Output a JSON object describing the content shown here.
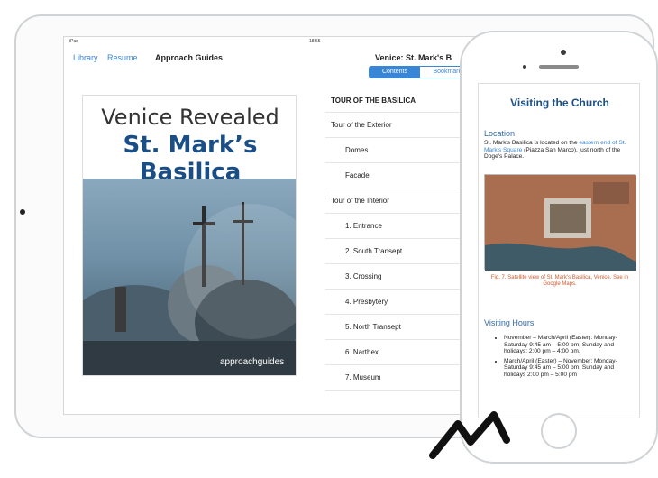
{
  "ipad": {
    "status": {
      "left": "iPad",
      "time": "18:55"
    },
    "nav": {
      "library": "Library",
      "resume": "Resume",
      "title": "Approach Guides",
      "doc_title": "Venice: St. Mark's B"
    },
    "segmented": {
      "selected": "Contents",
      "other": "Bookmarks"
    },
    "cover": {
      "title": "Venice Revealed",
      "subtitle": "St. Mark’s Basilica",
      "logo_text": "approachguides"
    },
    "toc": {
      "section_header": "TOUR OF THE BASILICA",
      "items": [
        {
          "label": "Tour of the Exterior",
          "indent": false
        },
        {
          "label": "Domes",
          "indent": true
        },
        {
          "label": "Facade",
          "indent": true
        },
        {
          "label": "Tour of the Interior",
          "indent": false
        },
        {
          "label": "1. Entrance",
          "indent": true
        },
        {
          "label": "2. South Transept",
          "indent": true
        },
        {
          "label": "3. Crossing",
          "indent": true
        },
        {
          "label": "4. Presbytery",
          "indent": true
        },
        {
          "label": "5. North Transept",
          "indent": true
        },
        {
          "label": "6. Narthex",
          "indent": true
        },
        {
          "label": "7. Museum",
          "indent": true
        }
      ]
    }
  },
  "iphone": {
    "page_title": "Visiting the Church",
    "location_heading": "Location",
    "location_text_1": "St. Mark's Basilica is located on the ",
    "location_link": "eastern end of St. Mark's Square",
    "location_text_2": " (Piazza San Marco), just north of the Doge's Palace.",
    "figure_caption": "Fig. 7. Satellite view of St. Mark's Basilica, Venice. See in Google Maps.",
    "hours_heading": "Visiting Hours",
    "hours_items": [
      "November – March/April (Easter): Monday-Saturday 9:45 am – 5:00 pm; Sunday and holidays: 2:00 pm – 4:00 pm.",
      "March/April (Easter) – November: Monday-Saturday 9:45 am – 5:00 pm; Sunday and holidays 2:00 pm – 5:00 pm"
    ]
  }
}
